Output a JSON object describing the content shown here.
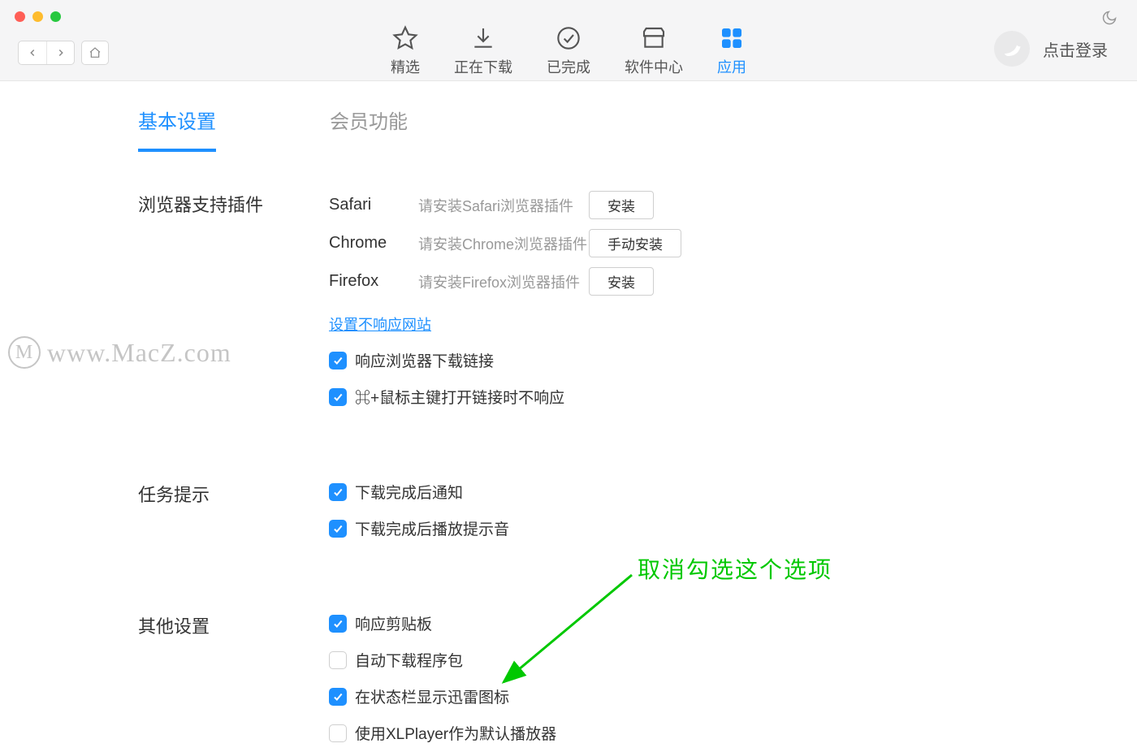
{
  "toolbar": {
    "tabs": [
      {
        "label": "精选"
      },
      {
        "label": "正在下载"
      },
      {
        "label": "已完成"
      },
      {
        "label": "软件中心"
      },
      {
        "label": "应用"
      }
    ],
    "login_text": "点击登录"
  },
  "page_tabs": {
    "basic": "基本设置",
    "member": "会员功能"
  },
  "sections": {
    "browser": {
      "title": "浏览器支持插件",
      "rows": [
        {
          "name": "Safari",
          "hint": "请安装Safari浏览器插件",
          "button": "安装"
        },
        {
          "name": "Chrome",
          "hint": "请安装Chrome浏览器插件",
          "button": "手动安装"
        },
        {
          "name": "Firefox",
          "hint": "请安装Firefox浏览器插件",
          "button": "安装"
        }
      ],
      "link": "设置不响应网站",
      "checks": [
        {
          "label": "响应浏览器下载链接",
          "checked": true
        },
        {
          "label": "⌘+鼠标主键打开链接时不响应",
          "checked": true
        }
      ]
    },
    "tasks": {
      "title": "任务提示",
      "checks": [
        {
          "label": "下载完成后通知",
          "checked": true
        },
        {
          "label": "下载完成后播放提示音",
          "checked": true
        }
      ]
    },
    "other": {
      "title": "其他设置",
      "checks": [
        {
          "label": "响应剪贴板",
          "checked": true
        },
        {
          "label": "自动下载程序包",
          "checked": false
        },
        {
          "label": "在状态栏显示迅雷图标",
          "checked": true
        },
        {
          "label": "使用XLPlayer作为默认播放器",
          "checked": false
        }
      ]
    }
  },
  "annotation": "取消勾选这个选项",
  "watermark": "www.MacZ.com"
}
